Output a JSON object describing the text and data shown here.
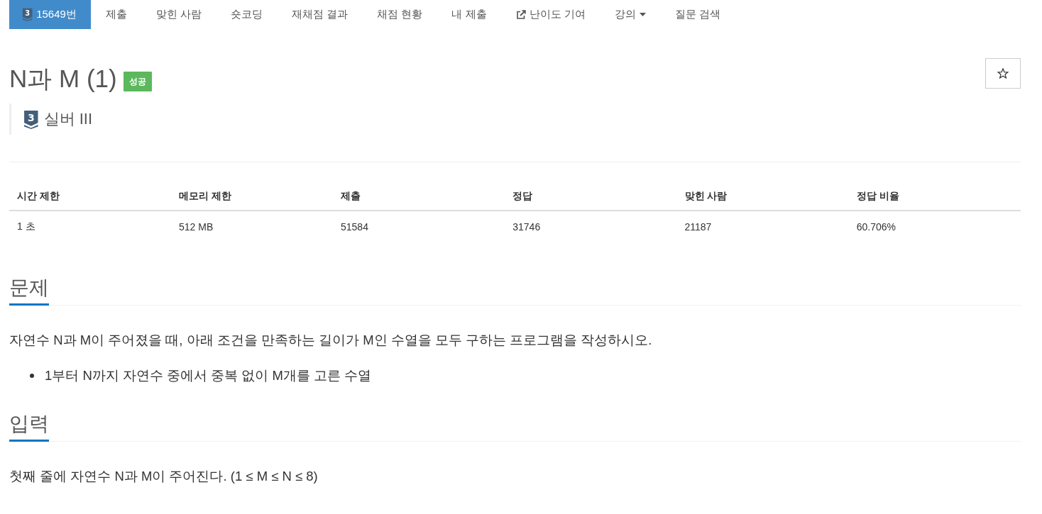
{
  "nav": {
    "tabs": [
      {
        "kind": "problem",
        "tier_number": "3",
        "label": "15649번",
        "selected": true
      },
      {
        "kind": "plain",
        "label": "제출",
        "selected": false
      },
      {
        "kind": "plain",
        "label": "맞힌 사람",
        "selected": false
      },
      {
        "kind": "plain",
        "label": "숏코딩",
        "selected": false
      },
      {
        "kind": "plain",
        "label": "재채점 결과",
        "selected": false
      },
      {
        "kind": "plain",
        "label": "채점 현황",
        "selected": false
      },
      {
        "kind": "plain",
        "label": "내 제출",
        "selected": false
      },
      {
        "kind": "external",
        "label": "난이도 기여",
        "selected": false
      },
      {
        "kind": "dropdown",
        "label": "강의",
        "selected": false
      },
      {
        "kind": "plain",
        "label": "질문 검색",
        "selected": false
      }
    ]
  },
  "problem": {
    "title": "N과 M (1)",
    "result_badge": "성공",
    "starred": false,
    "tier": {
      "number": "3",
      "name": "실버 III"
    }
  },
  "stats": {
    "columns": [
      "시간 제한",
      "메모리 제한",
      "제출",
      "정답",
      "맞힌 사람",
      "정답 비율"
    ],
    "rows": [
      [
        "1 초",
        "512 MB",
        "51584",
        "31746",
        "21187",
        "60.706%"
      ]
    ]
  },
  "sections": [
    {
      "heading": "문제",
      "blocks": [
        {
          "kind": "paragraph",
          "text": "자연수 N과 M이 주어졌을 때, 아래 조건을 만족하는 길이가 M인 수열을 모두 구하는 프로그램을 작성하시오."
        },
        {
          "kind": "bullet",
          "text": "1부터 N까지 자연수 중에서 중복 없이 M개를 고른 수열"
        }
      ]
    },
    {
      "heading": "입력",
      "blocks": [
        {
          "kind": "paragraph",
          "text": "첫째 줄에 자연수 N과 M이 주어진다. (1 ≤ M ≤ N ≤ 8)"
        }
      ]
    }
  ]
}
